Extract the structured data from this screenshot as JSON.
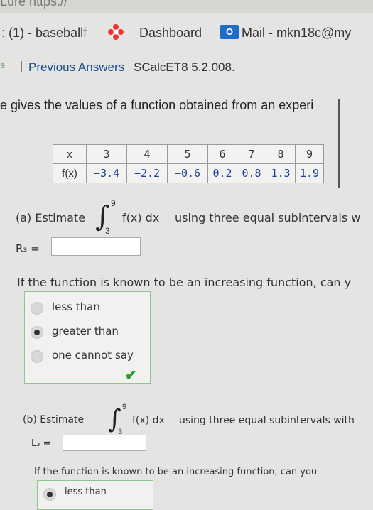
{
  "browser": {
    "url_fragment": "Lure    https://",
    "bookmarks": [
      {
        "label": "(1) - baseball",
        "faded": "f"
      },
      {
        "label": "Dashboard"
      },
      {
        "label": "Mail - mkn18c@my",
        "badge": "O"
      }
    ]
  },
  "breadcrumb": {
    "prefix": "s",
    "separator": "|",
    "previous_answers": "Previous Answers",
    "problem_code": "SCalcET8 5.2.008."
  },
  "problem": {
    "description": "e gives the values of a function obtained from an experi",
    "table": {
      "x_label": "x",
      "fx_label": "f(x)",
      "x_values": [
        "3",
        "4",
        "5",
        "6",
        "7",
        "8",
        "9"
      ],
      "fx_values": [
        "−3.4",
        "−2.2",
        "−0.6",
        "0.2",
        "0.8",
        "1.3",
        "1.9"
      ]
    }
  },
  "part_a": {
    "prefix": "(a) Estimate",
    "upper": "9",
    "lower": "3",
    "integrand": "f(x) dx",
    "suffix": "using three equal subintervals w",
    "answer_label": "R₃ =",
    "answer_value": "",
    "question": "If the function is known to be an increasing function, can y",
    "options": [
      {
        "label": "less than",
        "selected": false
      },
      {
        "label": "greater than",
        "selected": true
      },
      {
        "label": "one cannot say",
        "selected": false
      }
    ],
    "status": "correct"
  },
  "part_b": {
    "prefix": "(b) Estimate",
    "upper": "9",
    "lower": "3",
    "integrand": "f(x) dx",
    "suffix": "using three equal subintervals with",
    "answer_label": "L₃ =",
    "answer_value": "",
    "question": "If the function is known to be an increasing function, can you",
    "options": [
      {
        "label": "less than",
        "selected": true
      }
    ]
  }
}
